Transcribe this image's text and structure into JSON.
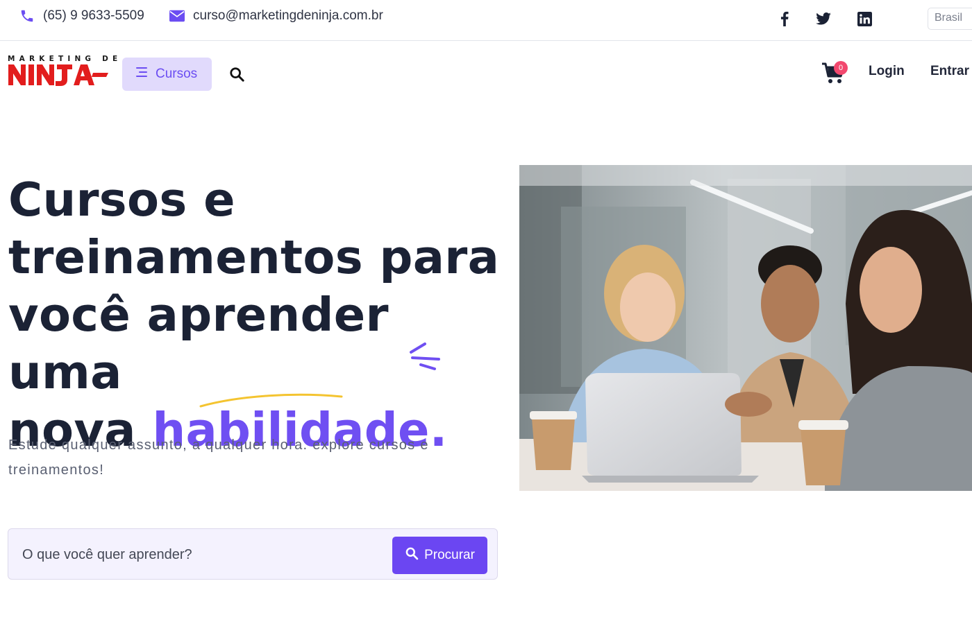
{
  "topbar": {
    "phone": "(65) 9 9633-5509",
    "email": "curso@marketingdeninja.com.br",
    "social": [
      "facebook-icon",
      "twitter-icon",
      "linkedin-icon"
    ],
    "language": "Brasil"
  },
  "nav": {
    "logo_top": "MARKETING DE",
    "logo_main": "NINJA",
    "cursos_label": "Cursos",
    "cart_count": "0",
    "login_label": "Login",
    "entrar_label": "Entrar"
  },
  "hero": {
    "title_line1": "Cursos e",
    "title_line2": "treinamentos para",
    "title_line3": "você aprender uma",
    "title_line4_prefix": "nova ",
    "title_highlight": "habilidade.",
    "subtitle": "Estude qualquer assunto, a qualquer hora. explore cursos e treinamentos!",
    "search_placeholder": "O que você quer aprender?",
    "search_button": "Procurar"
  },
  "colors": {
    "accent": "#6b46f2",
    "accent_light": "#e1dafc",
    "badge": "#f2486e",
    "logo_red": "#e21d1d",
    "underline_yellow": "#f4c430"
  }
}
